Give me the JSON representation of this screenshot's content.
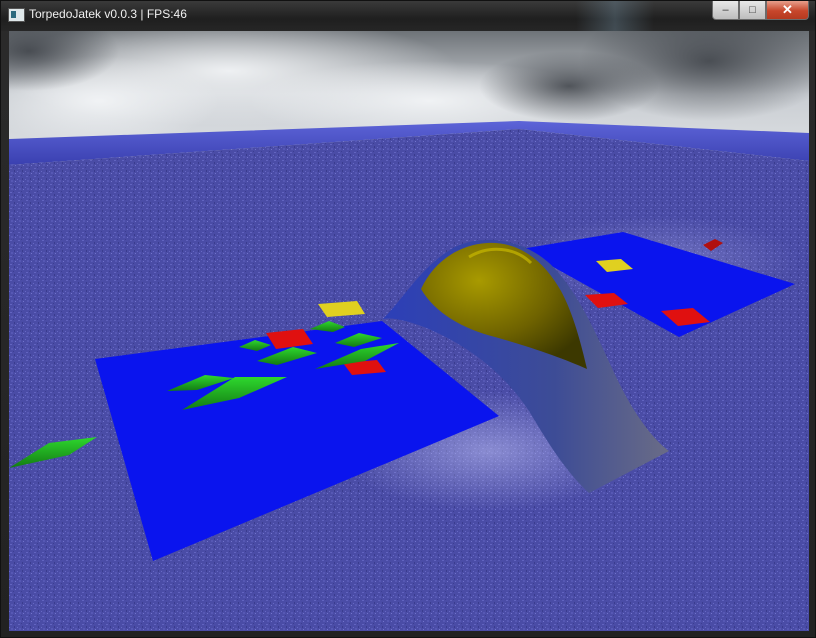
{
  "window": {
    "title": "TorpedoJatek v0.0.3  | FPS:46",
    "controls": {
      "minimize_glyph": "–",
      "maximize_glyph": "□",
      "close_glyph": "✕"
    }
  },
  "scene": {
    "water_color": "#4a4fa8",
    "wall_color": "#4d55c8",
    "board_color": "#0a14ee",
    "island_color": "#7a6a00",
    "ship_color": "#1faa1f",
    "hit_marker_color": "#e01010",
    "target_marker_color": "#e0d020"
  }
}
